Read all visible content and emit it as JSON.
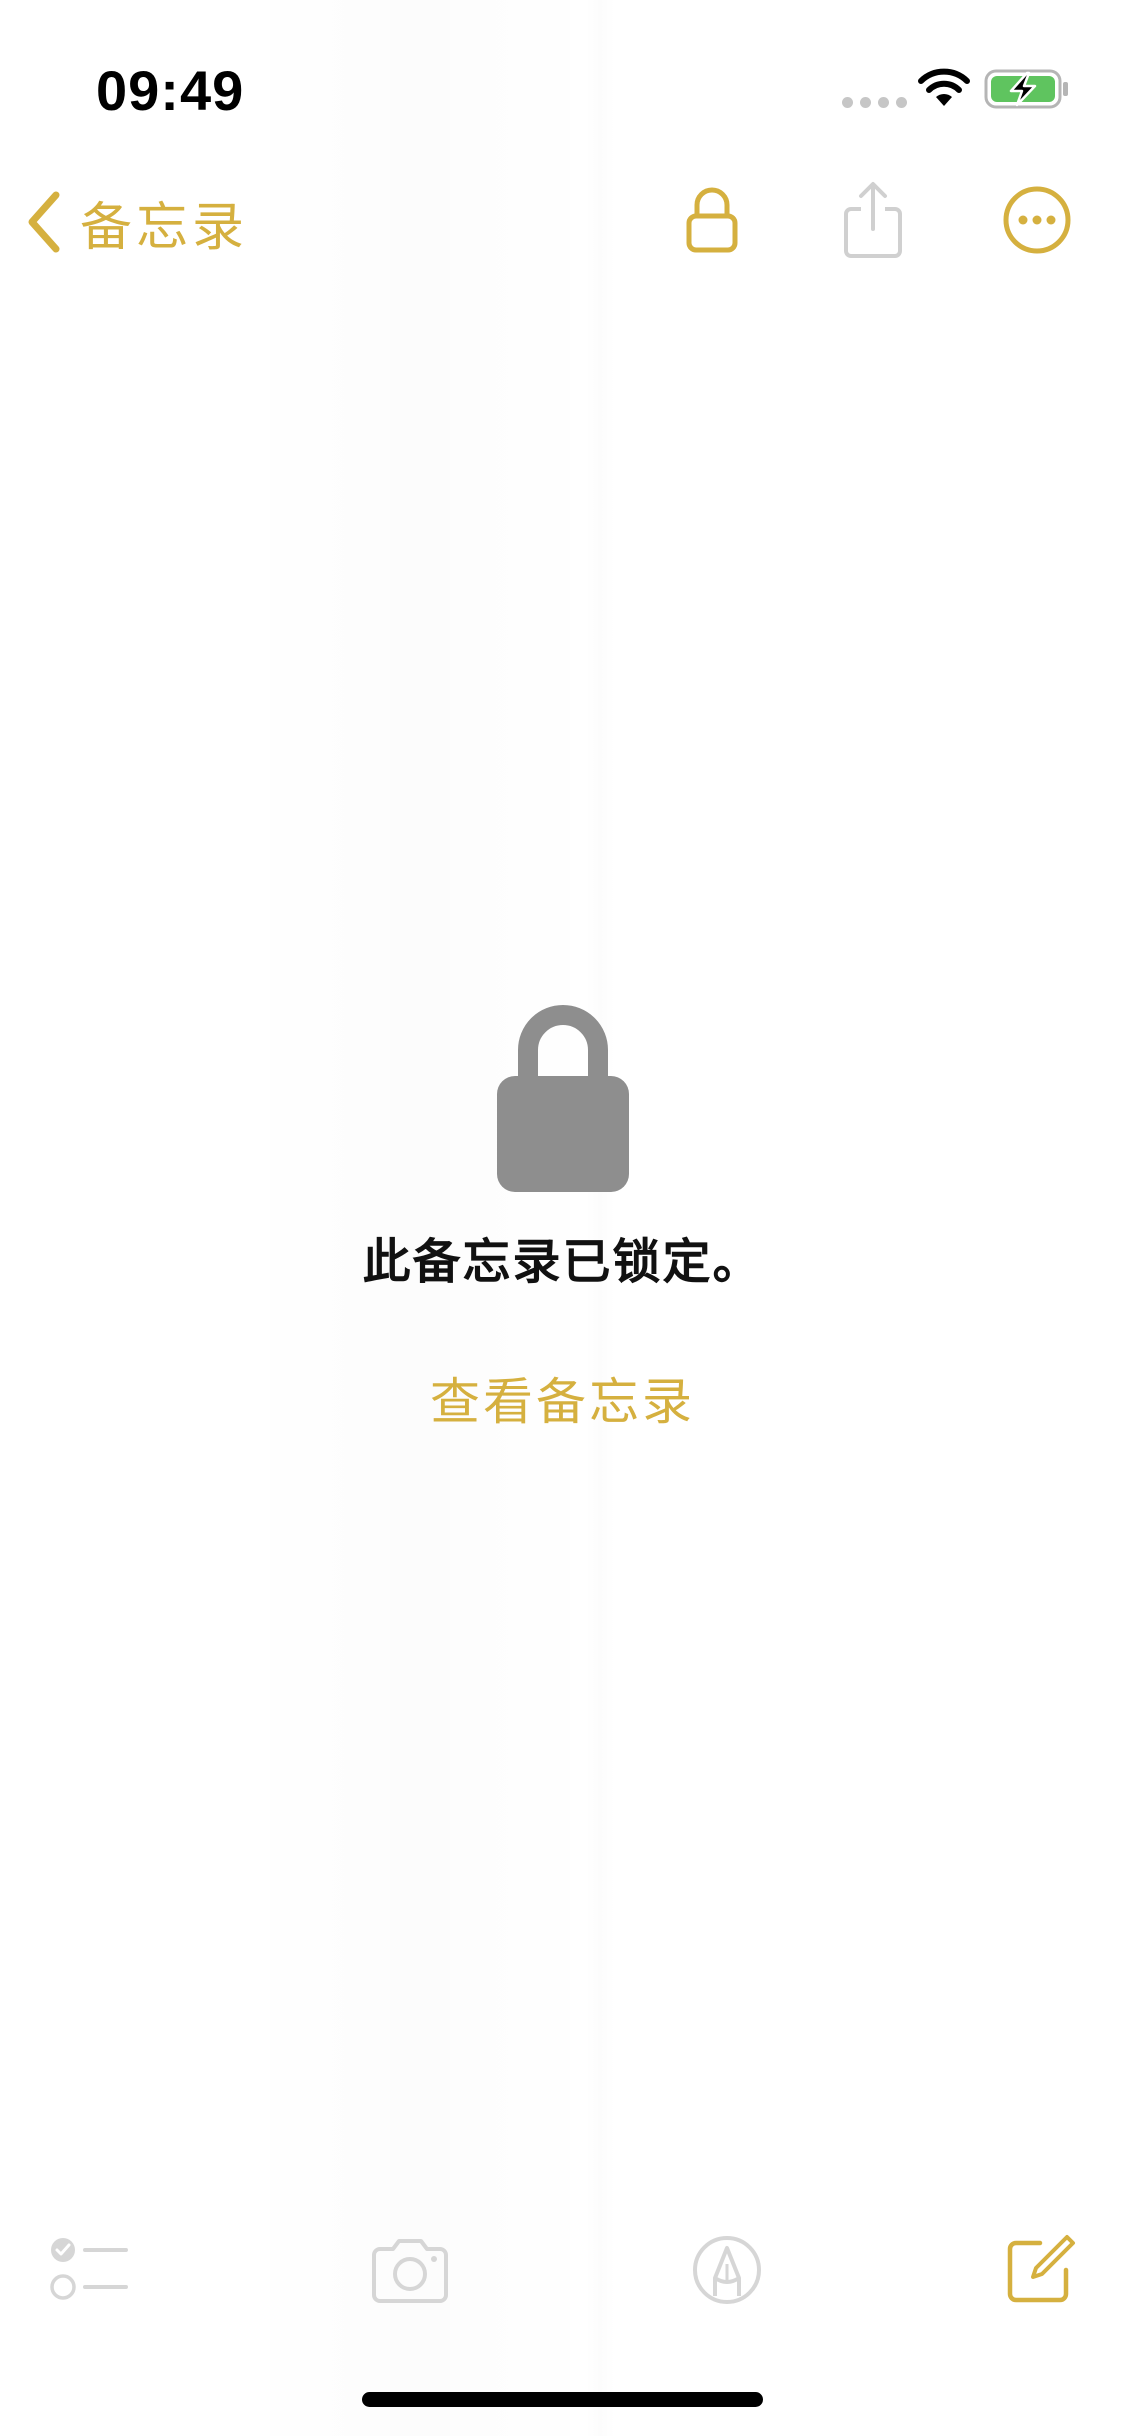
{
  "status_bar": {
    "time": "09:49"
  },
  "nav": {
    "back_label": "备忘录",
    "icons": [
      "chevron-left-icon",
      "lock-icon",
      "share-icon",
      "more-icon"
    ]
  },
  "locked": {
    "message": "此备忘录已锁定。",
    "view_button": "查看备忘录",
    "lock_icon": "lock-icon"
  },
  "toolbar": {
    "icons": [
      "checklist-icon",
      "camera-icon",
      "markup-icon",
      "compose-icon"
    ]
  },
  "colors": {
    "accent": "#D5B03F",
    "lock_gray": "#8E8E8E",
    "disabled_gray": "#D6D6D6"
  }
}
